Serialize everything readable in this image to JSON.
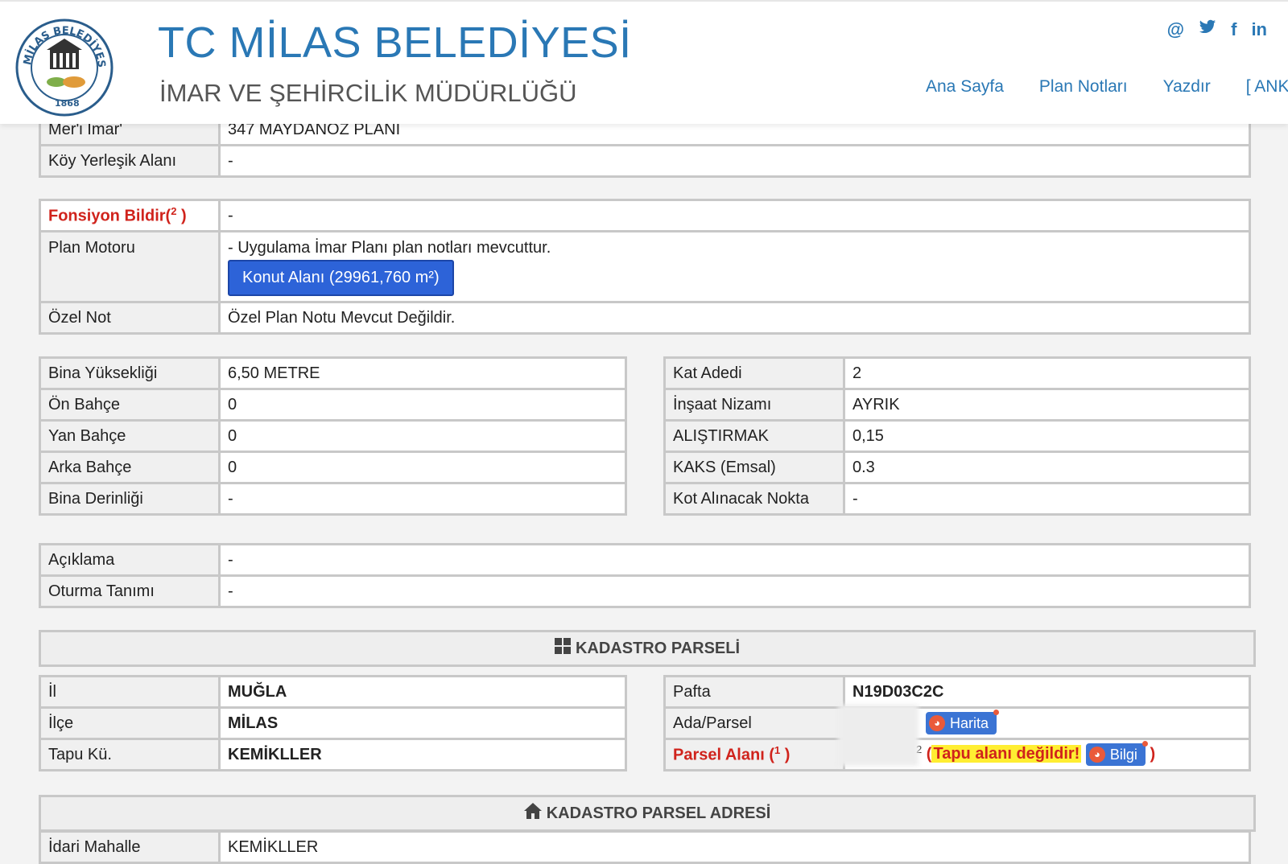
{
  "header": {
    "title": "TC MİLAS BELEDİYESİ",
    "subtitle": "İMAR VE ŞEHİRCİLİK MÜDÜRLÜĞÜ",
    "logo_text_top": "MİLAS BELEDİYESİ",
    "logo_year": "1868",
    "social": [
      "@",
      "t",
      "f",
      "in"
    ],
    "nav": [
      "Ana Sayfa",
      "Plan Notları",
      "Yazdır",
      "[ ANK"
    ]
  },
  "plan": {
    "meri_imar_label": "Mer'i İmar'",
    "meri_imar_value": "347 MAYDANOZ PLANI",
    "koy_label": "Köy Yerleşik Alanı",
    "koy_value": "-"
  },
  "notes": {
    "fonksiyon_label": "Fonsiyon Bildir(",
    "fonksiyon_sup": "2",
    "fonksiyon_close": " )",
    "fonksiyon_value": "-",
    "motor_label": "Plan Motoru",
    "motor_value": "- Uygulama İmar Planı plan notları mevcuttur.",
    "konut_button": "Konut Alanı (29961,760 m²)",
    "ozel_label": "Özel Not",
    "ozel_value": "Özel Plan Notu Mevcut Değildir."
  },
  "left_props": [
    {
      "label": "Bina Yüksekliği",
      "value": "6,50 METRE"
    },
    {
      "label": "Ön Bahçe",
      "value": "0"
    },
    {
      "label": "Yan Bahçe",
      "value": "0"
    },
    {
      "label": "Arka Bahçe",
      "value": "0"
    },
    {
      "label": "Bina Derinliği",
      "value": "-"
    }
  ],
  "right_props": [
    {
      "label": "Kat Adedi",
      "value": "2"
    },
    {
      "label": "İnşaat Nizamı",
      "value": "AYRIK"
    },
    {
      "label": "ALIŞTIRMAK",
      "value": "0,15"
    },
    {
      "label": "KAKS (Emsal)",
      "value": "0.3"
    },
    {
      "label": "Kot Alınacak Nokta",
      "value": "-"
    }
  ],
  "extra": [
    {
      "label": "Açıklama",
      "value": "-"
    },
    {
      "label": "Oturma Tanımı",
      "value": "-"
    }
  ],
  "kadastro": {
    "title": "KADASTRO PARSELİ",
    "il_label": "İl",
    "il_value": "MUĞLA",
    "ilce_label": "İlçe",
    "ilce_value": "MİLAS",
    "tapu_label": "Tapu Kü.",
    "tapu_value": "KEMİKLLER",
    "pafta_label": "Pafta",
    "pafta_value": "N19D03C2C",
    "ada_label": "Ada/Parsel",
    "harita_button": "Harita",
    "parsel_label": "Parsel Alanı (",
    "parsel_sup": "1",
    "parsel_close": " )",
    "parsel_unit_sup": "2",
    "paren_open": "(",
    "warning": "Tapu alanı değildir!",
    "bilgi_button": "Bilgi",
    "paren_close": " )"
  },
  "adres": {
    "title": "KADASTRO PARSEL ADRESİ",
    "mahalle_label": "İdari Mahalle",
    "mahalle_value": "KEMİKLLER"
  },
  "colors": {
    "brand_blue": "#2a78b5",
    "warning_red": "#d0231c",
    "button_blue": "#2d63d8",
    "highlight": "#ffee32"
  }
}
